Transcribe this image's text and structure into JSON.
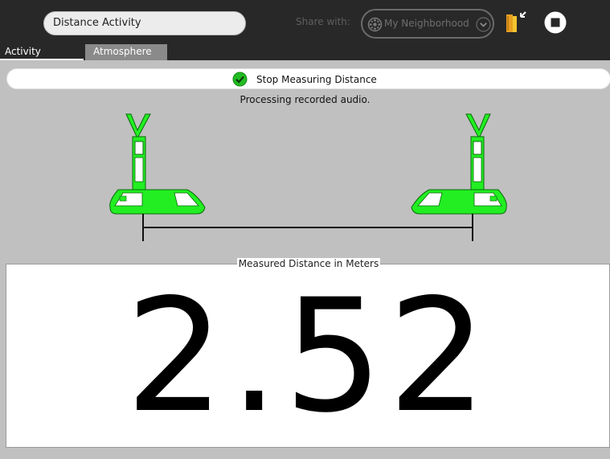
{
  "toolbar": {
    "title_value": "Distance Activity",
    "share_label": "Share with:",
    "share_selected": "My Neighborhood",
    "icons": {
      "neighborhood": "neighborhood-icon",
      "dropdown": "chevron-down-icon",
      "keep": "keep-journal-icon",
      "stop": "stop-icon"
    }
  },
  "tabs": [
    {
      "label": "Activity",
      "active": true
    },
    {
      "label": "Atmosphere",
      "active": false
    }
  ],
  "measure": {
    "button_label": "Stop Measuring Distance",
    "status": "Processing recorded audio."
  },
  "result": {
    "title": "Measured Distance in Meters",
    "value": "2.52"
  },
  "colors": {
    "toolbar_bg": "#282828",
    "panel_bg": "#c0c0c0",
    "laptop_green": "#22ee22",
    "check_green": "#22bb22"
  }
}
